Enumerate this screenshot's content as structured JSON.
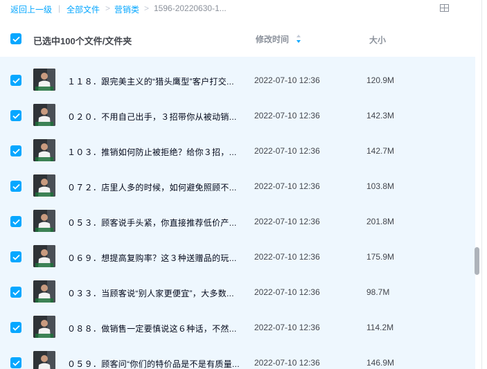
{
  "breadcrumb": {
    "back": "返回上一级",
    "sep": "|",
    "all_files": "全部文件",
    "arrow": ">",
    "folder": "营销类",
    "current": "1596-20220630-1..."
  },
  "header": {
    "selected_count": "已选中100个文件/文件夹",
    "col_mtime": "修改时间",
    "col_size": "大小"
  },
  "colors": {
    "accent": "#06a7ff",
    "row_bg": "#eef7fe"
  },
  "files": [
    {
      "name": "１１８．跟完美主义的“猎头鹰型”客户打交...",
      "mtime": "2022-07-10 12:36",
      "size": "120.9M",
      "checked": true
    },
    {
      "name": "０２０．不用自己出手，３招带你从被动销...",
      "mtime": "2022-07-10 12:36",
      "size": "142.3M",
      "checked": true
    },
    {
      "name": "１０３．推销如何防止被拒绝？给你３招，...",
      "mtime": "2022-07-10 12:36",
      "size": "142.7M",
      "checked": true
    },
    {
      "name": "０７２．店里人多的时候，如何避免照顾不...",
      "mtime": "2022-07-10 12:36",
      "size": "103.8M",
      "checked": true
    },
    {
      "name": "０５３．顾客说手头紧，你直接推荐低价产...",
      "mtime": "2022-07-10 12:36",
      "size": "201.8M",
      "checked": true
    },
    {
      "name": "０６９．想提高复购率？这３种送赠品的玩...",
      "mtime": "2022-07-10 12:36",
      "size": "175.9M",
      "checked": true
    },
    {
      "name": "０３３．当顾客说“别人家更便宜”，大多数...",
      "mtime": "2022-07-10 12:36",
      "size": "98.7M",
      "checked": true
    },
    {
      "name": "０８８．做销售一定要慎说这６种话，不然...",
      "mtime": "2022-07-10 12:36",
      "size": "114.2M",
      "checked": true
    },
    {
      "name": "０５９．顾客问“你们的特价品是不是有质量...",
      "mtime": "2022-07-10 12:36",
      "size": "146.9M",
      "checked": true
    }
  ]
}
